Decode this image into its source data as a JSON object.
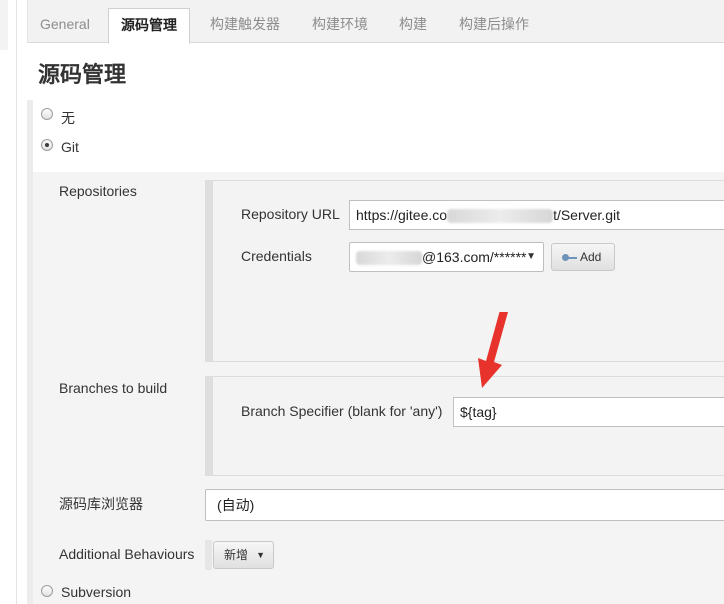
{
  "tabs": [
    {
      "label": "General"
    },
    {
      "label": "源码管理"
    },
    {
      "label": "构建触发器"
    },
    {
      "label": "构建环境"
    },
    {
      "label": "构建"
    },
    {
      "label": "构建后操作"
    }
  ],
  "section_title": "源码管理",
  "scm_options": {
    "none": "无",
    "git": "Git",
    "svn": "Subversion"
  },
  "git": {
    "repositories_label": "Repositories",
    "repo_url_label": "Repository URL",
    "repo_url_prefix": "https://gitee.co",
    "repo_url_suffix": "t/Server.git",
    "credentials_label": "Credentials",
    "credentials_suffix": "@163.com/******",
    "add_button": "Add",
    "branches_label": "Branches to build",
    "branch_specifier_label": "Branch Specifier (blank for 'any')",
    "branch_specifier_value": "${tag}",
    "browser_label": "源码库浏览器",
    "browser_value": "(自动)",
    "additional_label": "Additional Behaviours",
    "additional_button": "新增"
  },
  "colors": {
    "arrow": "#e8332c",
    "selected_tab_text": "#222222",
    "tab_text": "#8d8d8d"
  }
}
